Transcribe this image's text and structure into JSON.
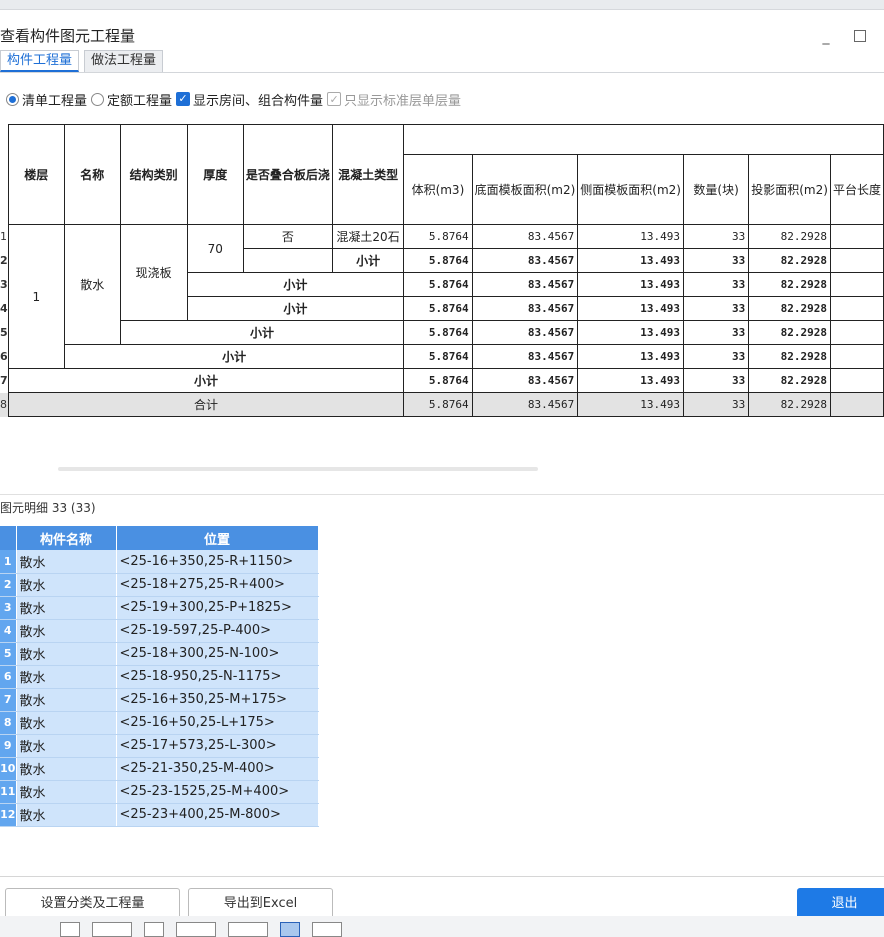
{
  "window": {
    "title": "查看构件图元工程量",
    "tabs": [
      "构件工程量",
      "做法工程量"
    ]
  },
  "options": {
    "radio_bill": "清单工程量",
    "radio_quota": "定额工程量",
    "check_room": "显示房间、组合构件量",
    "check_std": "只显示标准层单层量"
  },
  "summary": {
    "headers": [
      "楼层",
      "名称",
      "结构类别",
      "厚度",
      "是否叠合板后浇",
      "混凝土类型",
      "体积(m3)",
      "底面模板面积(m2)",
      "侧面模板面积(m2)",
      "数量(块)",
      "投影面积(m2)",
      "平台长度"
    ],
    "floor": "1",
    "name": "散水",
    "struct": "现浇板",
    "thickness": "70",
    "overlay": "否",
    "concrete": "混凝土20石",
    "subtotal": "小计",
    "total": "合计",
    "rownums": [
      "1",
      "2",
      "3",
      "4",
      "5",
      "6",
      "7",
      "8"
    ],
    "values": [
      "5.8764",
      "83.4567",
      "13.493",
      "33",
      "82.2928"
    ]
  },
  "detail": {
    "title": "图元明细",
    "count": "33 (33)",
    "headers": [
      "构件名称",
      "位置"
    ],
    "rows": [
      {
        "n": "1",
        "name": "散水",
        "pos": "<25-16+350,25-R+1150>"
      },
      {
        "n": "2",
        "name": "散水",
        "pos": "<25-18+275,25-R+400>"
      },
      {
        "n": "3",
        "name": "散水",
        "pos": "<25-19+300,25-P+1825>"
      },
      {
        "n": "4",
        "name": "散水",
        "pos": "<25-19-597,25-P-400>"
      },
      {
        "n": "5",
        "name": "散水",
        "pos": "<25-18+300,25-N-100>"
      },
      {
        "n": "6",
        "name": "散水",
        "pos": "<25-18-950,25-N-1175>"
      },
      {
        "n": "7",
        "name": "散水",
        "pos": "<25-16+350,25-M+175>"
      },
      {
        "n": "8",
        "name": "散水",
        "pos": "<25-16+50,25-L+175>"
      },
      {
        "n": "9",
        "name": "散水",
        "pos": "<25-17+573,25-L-300>"
      },
      {
        "n": "10",
        "name": "散水",
        "pos": "<25-21-350,25-M-400>"
      },
      {
        "n": "11",
        "name": "散水",
        "pos": "<25-23-1525,25-M+400>"
      },
      {
        "n": "12",
        "name": "散水",
        "pos": "<25-23+400,25-M-800>"
      }
    ]
  },
  "footer": {
    "classify": "设置分类及工程量",
    "excel": "导出到Excel",
    "exit": "退出"
  },
  "colors": {
    "accent": "#1e7ae6",
    "grid_header": "#4a90e2",
    "grid_cell": "#cfe4fb"
  }
}
